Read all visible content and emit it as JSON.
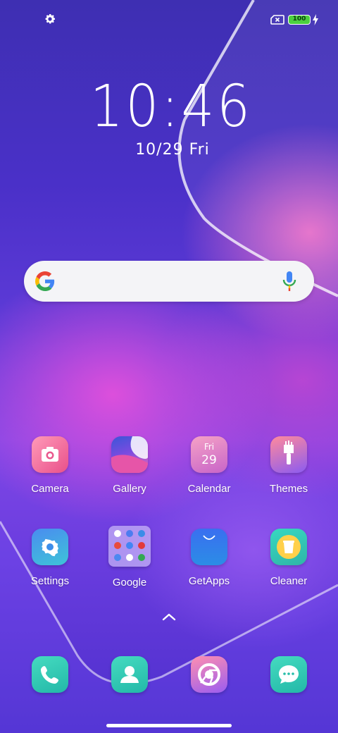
{
  "status_bar": {
    "settings_icon": "gear-icon",
    "sim_icon": "no-sim-icon",
    "battery_level": "100",
    "charging_icon": "bolt-icon"
  },
  "clock": {
    "time": "10:46",
    "date": "10/29 Fri"
  },
  "search_bar": {
    "logo": "google-g-icon",
    "mic": "mic-icon"
  },
  "apps_row1": [
    {
      "label": "Camera"
    },
    {
      "label": "Gallery"
    },
    {
      "label": "Calendar",
      "icon_day": "Fri",
      "icon_date": "29"
    },
    {
      "label": "Themes"
    }
  ],
  "apps_row2": [
    {
      "label": "Settings"
    },
    {
      "label": "Google"
    },
    {
      "label": "GetApps"
    },
    {
      "label": "Cleaner"
    }
  ],
  "dock": [
    {
      "icon": "phone-icon"
    },
    {
      "icon": "contacts-icon"
    },
    {
      "icon": "chrome-icon"
    },
    {
      "icon": "messages-icon"
    }
  ],
  "app_drawer_hint": "chevron-up-icon"
}
